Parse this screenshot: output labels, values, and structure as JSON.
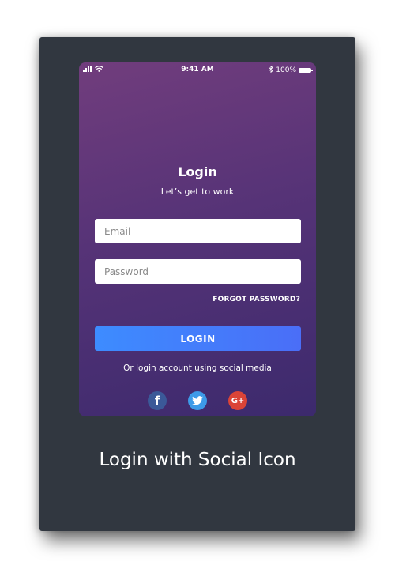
{
  "status_bar": {
    "time": "9:41 AM",
    "battery": "100%",
    "icons": [
      "signal-icon",
      "wifi-icon",
      "bluetooth-icon",
      "battery-icon"
    ]
  },
  "login": {
    "title": "Login",
    "subtitle": "Let’s get to work",
    "email_placeholder": "Email",
    "password_placeholder": "Password",
    "forgot_password": "FORGOT PASSWORD?",
    "login_button": "LOGIN",
    "social_text": "Or login account using social media"
  },
  "social": [
    {
      "name": "facebook-icon",
      "glyph": "f",
      "color": "#3b5998"
    },
    {
      "name": "twitter-icon",
      "glyph": "",
      "color": "#3d9ae8"
    },
    {
      "name": "google-plus-icon",
      "glyph": "G+",
      "color": "#db4437"
    }
  ],
  "caption": "Login with Social Icon",
  "colors": {
    "card_background": "#313740",
    "gradient_top": "#713d7d",
    "gradient_bottom": "#3c2a6d",
    "button_blue": "#3d8cff"
  }
}
